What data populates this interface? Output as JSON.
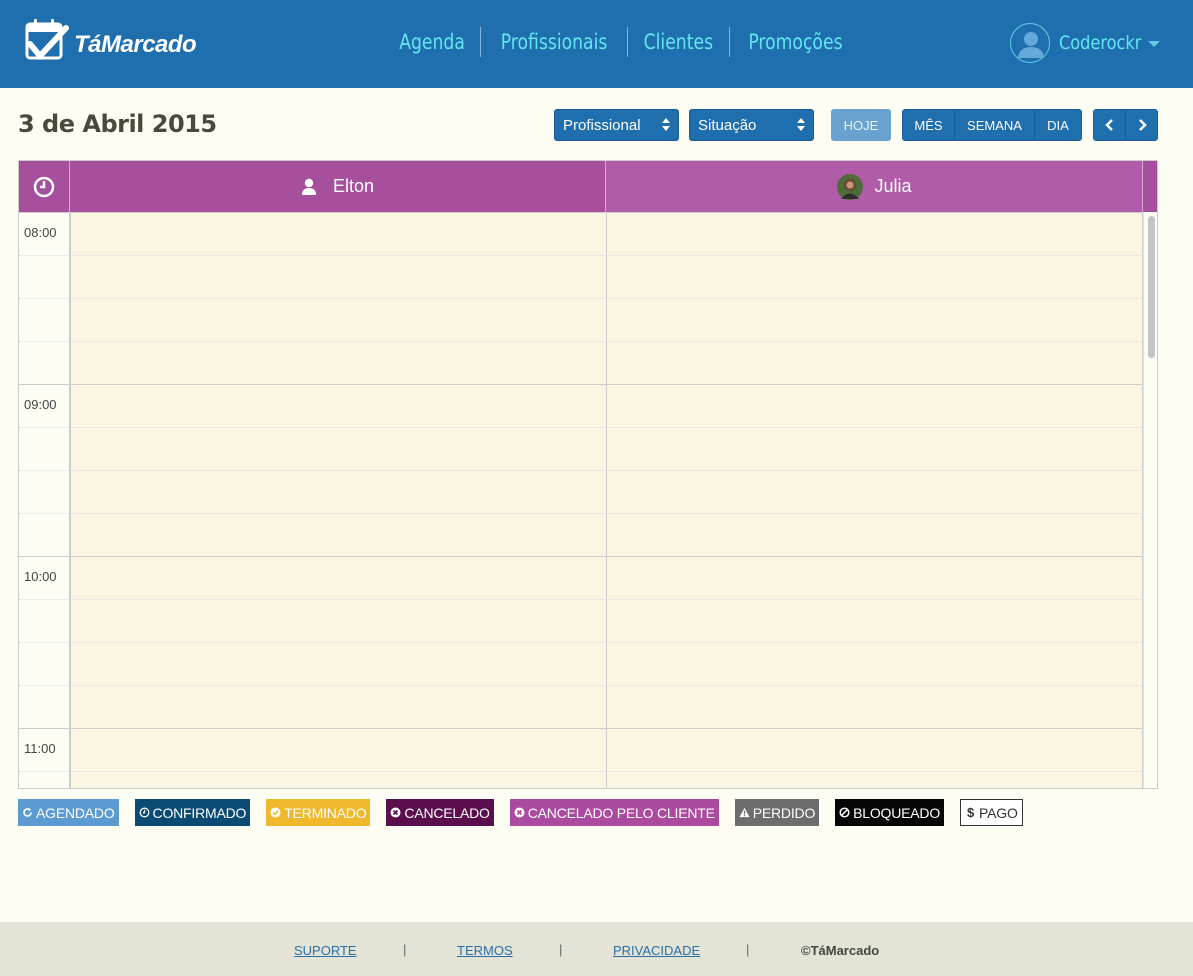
{
  "header": {
    "logo_text": "TáMarcado",
    "nav": [
      "Agenda",
      "Profissionais",
      "Clientes",
      "Promoções"
    ],
    "user_name": "Coderockr"
  },
  "toolbar": {
    "date_title": "3 de Abril 2015",
    "select_professional": "Profissional",
    "select_status": "Situação",
    "today_label": "HOJE",
    "view_month": "MÊS",
    "view_week": "SEMANA",
    "view_day": "DIA"
  },
  "calendar": {
    "columns": [
      {
        "name": "Elton",
        "icon": "user-icon"
      },
      {
        "name": "Julia",
        "icon": "photo-avatar"
      }
    ],
    "times": [
      "08:00",
      "09:00",
      "10:00",
      "11:00"
    ],
    "header_color": "#a64f9d",
    "cell_color": "#faf6e1"
  },
  "legend": [
    {
      "label": "AGENDADO",
      "icon": "refresh-icon",
      "color": "#5b9bd1"
    },
    {
      "label": "CONFIRMADO",
      "icon": "clock-icon",
      "color": "#0b4a73"
    },
    {
      "label": "TERMINADO",
      "icon": "check-circle-icon",
      "color": "#f0b92d"
    },
    {
      "label": "CANCELADO",
      "icon": "x-circle-icon",
      "color": "#5a0e4d"
    },
    {
      "label": "CANCELADO PELO CLIENTE",
      "icon": "x-circle-icon",
      "color": "#ac4aa0"
    },
    {
      "label": "PERDIDO",
      "icon": "warning-icon",
      "color": "#6d6d6d"
    },
    {
      "label": "BLOQUEADO",
      "icon": "ban-icon",
      "color": "#050505"
    },
    {
      "label": "PAGO",
      "icon": "dollar-icon",
      "color": "#ffffff"
    }
  ],
  "footer": {
    "support": "SUPORTE",
    "terms": "TERMOS",
    "privacy": "PRIVACIDADE",
    "copyright": "©TáMarcado",
    "separator": "|"
  }
}
